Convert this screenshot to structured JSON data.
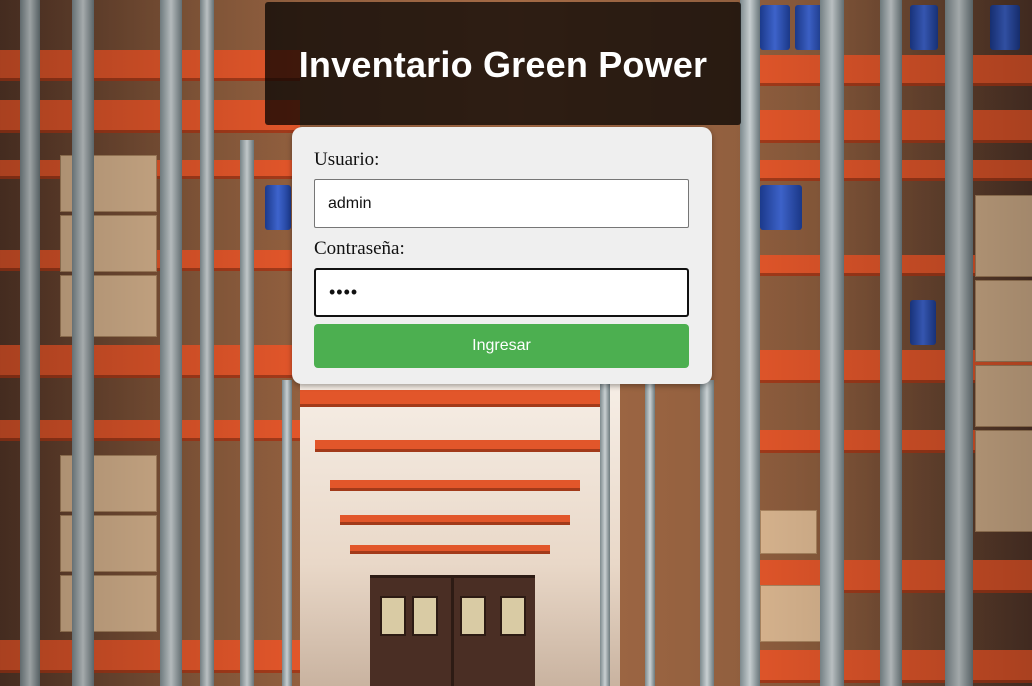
{
  "header": {
    "title": "Inventario Green Power"
  },
  "login_form": {
    "username_label": "Usuario:",
    "username_value": "admin",
    "password_label": "Contraseña:",
    "password_value": "pass",
    "submit_label": "Ingresar"
  },
  "colors": {
    "submit_button": "#4caf50",
    "card_background": "#efefef",
    "banner_background": "#000000b8"
  },
  "background": {
    "image_description_icon": "warehouse-aisle-background"
  }
}
